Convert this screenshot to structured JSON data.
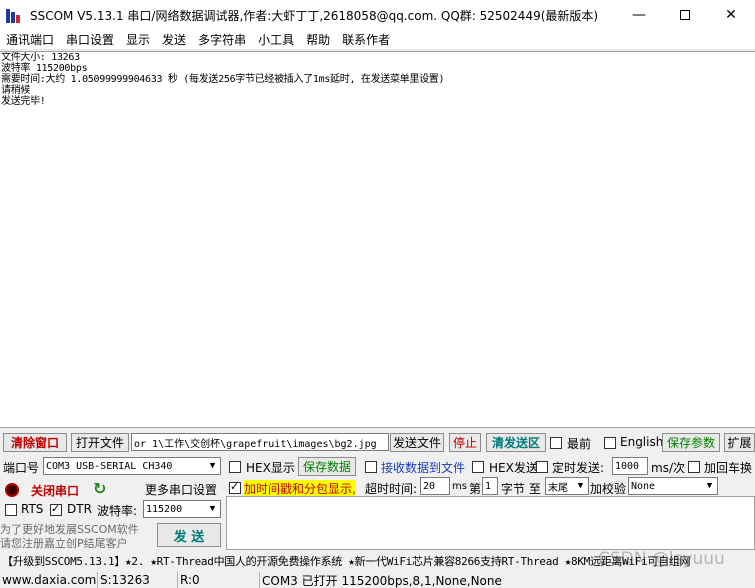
{
  "titlebar": {
    "title": "SSCOM V5.13.1 串口/网络数据调试器,作者:大虾丁丁,2618058@qq.com. QQ群: 52502449(最新版本)",
    "minimize": "—",
    "close": "✕"
  },
  "menu": [
    "通讯端口",
    "串口设置",
    "显示",
    "发送",
    "多字符串",
    "小工具",
    "帮助",
    "联系作者"
  ],
  "receive": {
    "lines": [
      "文件大小: 13263",
      "波特率 115200bps",
      "需要时间:大约 1.05099999904633 秒 (每发送256字节已经被插入了1ms延时, 在发送菜单里设置)",
      "请稍候",
      "发送完毕!"
    ]
  },
  "toolbar": {
    "clear_window": "清除窗口",
    "open_file": "打开文件",
    "file_path": "or 1\\工作\\交创杯\\grapefruit\\images\\bg2.jpg",
    "send_file": "发送文件",
    "stop": "停止",
    "clear_send": "清发送区",
    "topmost": "最前",
    "english": "English",
    "save_params": "保存参数",
    "expand": "扩展"
  },
  "port": {
    "port_label": "端口号",
    "port_value": "COM3 USB-SERIAL CH340",
    "hex_display": "HEX显示",
    "save_data": "保存数据",
    "recv_to_file": "接收数据到文件",
    "hex_send": "HEX发送",
    "timed_send": "定时发送:",
    "interval": "1000",
    "interval_unit": "ms/次",
    "add_crlf": "加回车换",
    "close_port": "关闭串口",
    "more_settings": "更多串口设置",
    "timestamp": "加时间戳和分包显示,",
    "timeout_label": "超时时间:",
    "timeout_value": "20",
    "timeout_unit": "ms",
    "nth_label": "第",
    "nth_value": "1",
    "byte_label": "字节 至",
    "tail_value": "末尾",
    "checksum_label": "加校验",
    "checksum_value": "None",
    "rts": "RTS",
    "dtr": "DTR",
    "baud_label": "波特率:",
    "baud_value": "115200",
    "promo_line1": "为了更好地发展SSCOM软件",
    "promo_line2": "请您注册嘉立创P结尾客户",
    "send": "发 送"
  },
  "ticker": "【升级到SSCOM5.13.1】★2. ★RT-Thread中国人的开源免费操作系统 ★新一代WiFi芯片兼容8266支持RT-Thread ★8KM远距离WiFi可自组网",
  "status": {
    "website": "www.daxia.com",
    "sent": "S:13263",
    "received": "R:0",
    "port_state": "COM3 已打开  115200bps,8,1,None,None"
  },
  "watermark": "CSDN @lsyuuu",
  "colors": {
    "clear_red": "#c00000",
    "accent_green": "#008000",
    "highlight_yellow": "#ffff00"
  }
}
